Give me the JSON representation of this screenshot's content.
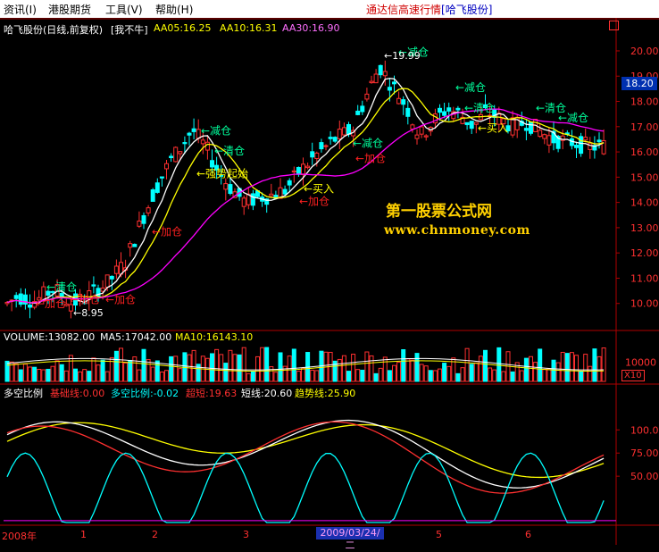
{
  "menu": {
    "items": [
      "资讯(I)",
      "港股期货",
      "工具(V)",
      "帮助(H)"
    ],
    "window_title": "通达信高速行情",
    "stock_in_title": "[哈飞股份]"
  },
  "price_panel": {
    "header": {
      "title": "哈飞股份(日线,前复权)",
      "indicator_name": "[我不牛]",
      "aa05": "AA05:16.25",
      "aa10": "AA10:16.31",
      "aa30": "AA30:16.90"
    },
    "current_price_badge": "18.20",
    "watermark": [
      "第一股票公式网",
      "www.chnmoney.com"
    ],
    "high_label": "19.99",
    "low_label": "8.95"
  },
  "volume_panel": {
    "header": {
      "volume": "VOLUME:13082.00",
      "ma5": "MA5:17042.00",
      "ma10": "MA10:16143.10"
    },
    "unit_label": "X10"
  },
  "indicator_panel": {
    "header": {
      "name": "多空比例",
      "base": "基础线:0.00",
      "ratio": "多空比例:-0.02",
      "ultra_short": "超短:19.63",
      "short": "短线:20.60",
      "trend": "趋势线:25.90"
    }
  },
  "date_axis": {
    "labels": [
      "2008年",
      "1",
      "2",
      "3",
      "4",
      "5",
      "6"
    ],
    "highlight": "2009/03/24/二"
  },
  "colors": {
    "up": "#ff3030",
    "down": "#00ffff",
    "ma5": "#ffffff",
    "ma10": "#ffff00",
    "ma30": "#ff00ff",
    "axis": "#b00000"
  },
  "chart_data": {
    "type": "candlestick",
    "price_axis": {
      "ticks": [
        10.0,
        11.0,
        12.0,
        13.0,
        14.0,
        15.0,
        16.0,
        17.0,
        18.0,
        19.0,
        20.0
      ],
      "ylim": [
        9.0,
        20.6
      ]
    },
    "volume_axis": {
      "ticks": [
        10000
      ],
      "ylim": [
        0,
        22000
      ]
    },
    "indicator_axis": {
      "ticks": [
        50.0,
        75.0,
        100.0
      ],
      "ylim": [
        0,
        135
      ]
    },
    "annotations": [
      {
        "text": "清仓",
        "x": 52,
        "color": "#00ff9c",
        "y_price": 10.5
      },
      {
        "text": "加仓",
        "x": 40,
        "color": "#ff2020",
        "y_price": 9.85
      },
      {
        "text": "加仓",
        "x": 78,
        "color": "#ff2020",
        "y_price": 10.0
      },
      {
        "text": "加仓",
        "x": 118,
        "color": "#ff2020",
        "y_price": 10.0
      },
      {
        "text": "加仓",
        "x": 170,
        "color": "#ff2020",
        "y_price": 12.7
      },
      {
        "text": "减仓",
        "x": 225,
        "color": "#00ff9c",
        "y_price": 16.7
      },
      {
        "text": "清仓",
        "x": 240,
        "color": "#00ff9c",
        "y_price": 15.9
      },
      {
        "text": "强势起始",
        "x": 220,
        "color": "#ffff00",
        "y_price": 15.0
      },
      {
        "text": "买入",
        "x": 340,
        "color": "#ffff00",
        "y_price": 14.4
      },
      {
        "text": "加仓",
        "x": 335,
        "color": "#ff2020",
        "y_price": 13.9
      },
      {
        "text": "减仓",
        "x": 395,
        "color": "#00ff9c",
        "y_price": 16.2
      },
      {
        "text": "加仓",
        "x": 398,
        "color": "#ff2020",
        "y_price": 15.6
      },
      {
        "text": "减仓",
        "x": 446,
        "color": "#00ff9c",
        "y_price": 19.8
      },
      {
        "text": "减仓",
        "x": 510,
        "color": "#00ff9c",
        "y_price": 18.4
      },
      {
        "text": "清仓",
        "x": 520,
        "color": "#00ff9c",
        "y_price": 17.6
      },
      {
        "text": "买入",
        "x": 535,
        "color": "#ffff00",
        "y_price": 16.8
      },
      {
        "text": "清仓",
        "x": 600,
        "color": "#00ff9c",
        "y_price": 17.6
      },
      {
        "text": "减仓",
        "x": 625,
        "color": "#00ff9c",
        "y_price": 17.2
      }
    ]
  }
}
